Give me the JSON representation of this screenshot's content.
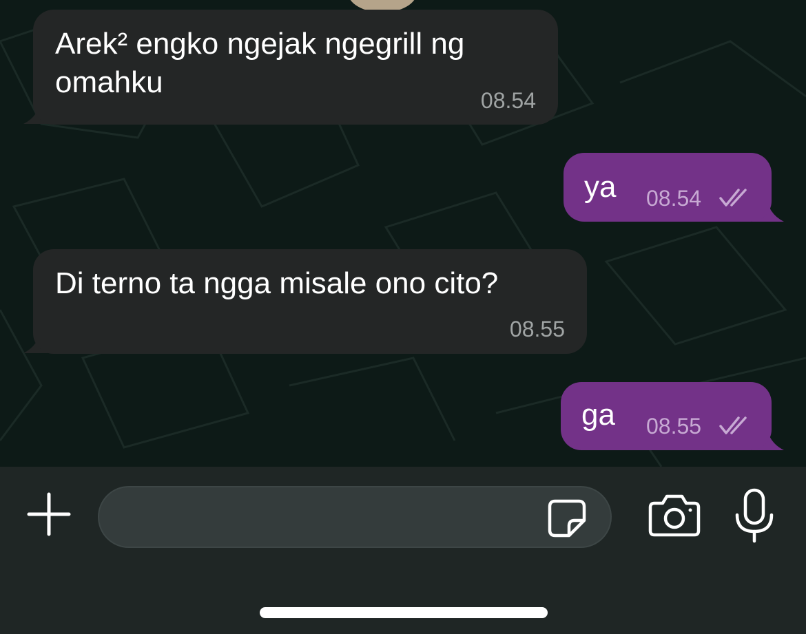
{
  "messages": [
    {
      "direction": "incoming",
      "text": "Arek² engko ngejak ngegrill ng\nomahku",
      "time": "08.54"
    },
    {
      "direction": "outgoing",
      "text": "ya",
      "time": "08.54",
      "status": "read-double-check-icon"
    },
    {
      "direction": "incoming",
      "text": "Di terno ta ngga misale ono cito?",
      "time": "08.55"
    },
    {
      "direction": "outgoing",
      "text": "ga",
      "time": "08.55",
      "status": "read-double-check-icon"
    }
  ],
  "composer": {
    "value": "",
    "icons": [
      "plus-icon",
      "sticker-icon",
      "camera-icon",
      "microphone-icon"
    ]
  },
  "colors": {
    "incoming_bubble": "#242626",
    "outgoing_bubble": "#733288",
    "chat_background": "#0d1a17",
    "input_bar": "#1f2625"
  }
}
